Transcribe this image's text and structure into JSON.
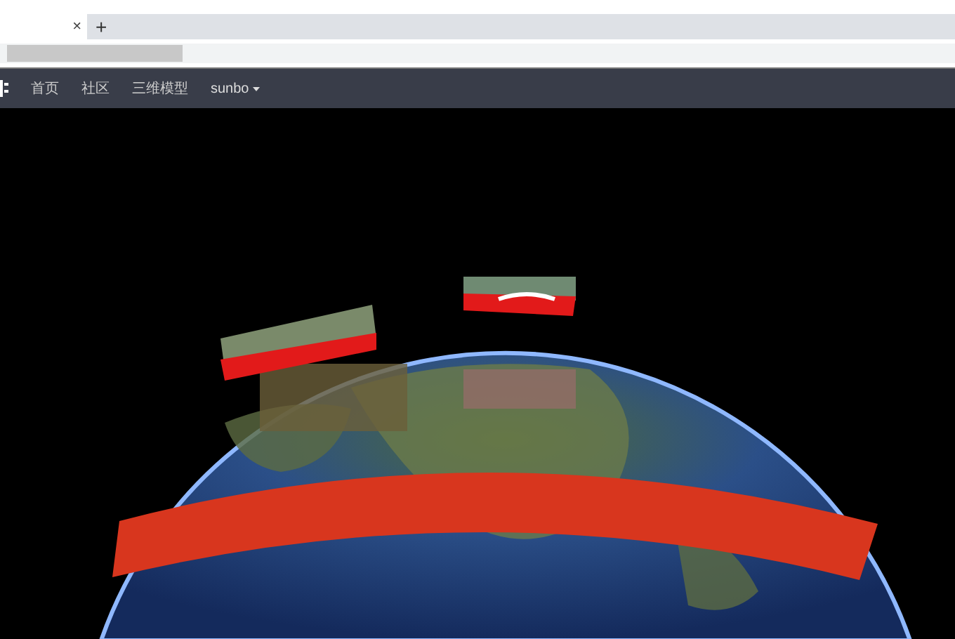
{
  "browser": {
    "tab": {
      "close": "×"
    },
    "new_tab": "+"
  },
  "nav": {
    "items": [
      {
        "label": "首页"
      },
      {
        "label": "社区"
      },
      {
        "label": "三维模型"
      }
    ],
    "user": {
      "label": "sunbo"
    }
  }
}
